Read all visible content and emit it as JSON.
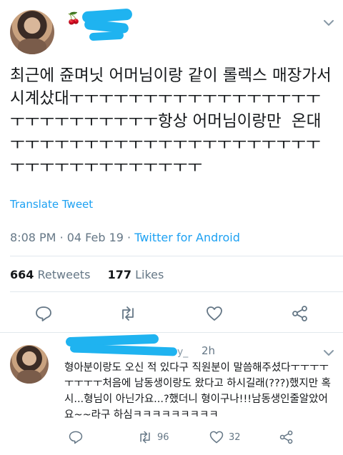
{
  "tweet": {
    "handle_fragment": "_",
    "text": "최근에 쥰며닛 어머님이랑 같이 롤렉스 매장가서 시계샀대ㅜㅜㅜㅜㅜㅜㅜㅜㅜㅜㅜㅜㅜㅜㅜㅜㅜㅜㅜㅜㅜㅜㅜㅜㅜㅜㅜ항상 어머님이랑만  온대ㅜㅜㅜㅜㅜㅜㅜㅜㅜㅜㅜㅜㅜㅜㅜㅜㅜㅜㅜㅜㅜㅜㅜㅜㅜㅜㅜㅜㅜㅜㅜㅜㅜㅜ",
    "translate_label": "Translate Tweet",
    "time": "8:08 PM",
    "date": "04 Feb 19",
    "source": "Twitter for Android",
    "retweets_count": "664",
    "retweets_label": "Retweets",
    "likes_count": "177",
    "likes_label": "Likes"
  },
  "reply": {
    "handle_fragment": "y_",
    "time": "2h",
    "text": "형아분이랑도 오신 적 있다구 직원분이 말씀해주셨다ㅜㅜㅜㅜㅜㅜㅜㅜ처음에 남동생이랑도 왔다고 하시길래(???)했지만 혹시...형님이 아닌가요...?했더니 형이구나!!!남동생인줄알았어요~~라구 하심ㅋㅋㅋㅋㅋㅋㅋㅋㅋ",
    "retweets_count": "96",
    "likes_count": "32"
  },
  "icons": {
    "reply": "reply-icon",
    "retweet": "retweet-icon",
    "like": "heart-icon",
    "share": "share-icon",
    "more": "chevron-down-icon"
  },
  "colors": {
    "accent": "#1da1f2",
    "secondary_text": "#657786",
    "redaction": "#1fb3f0"
  }
}
